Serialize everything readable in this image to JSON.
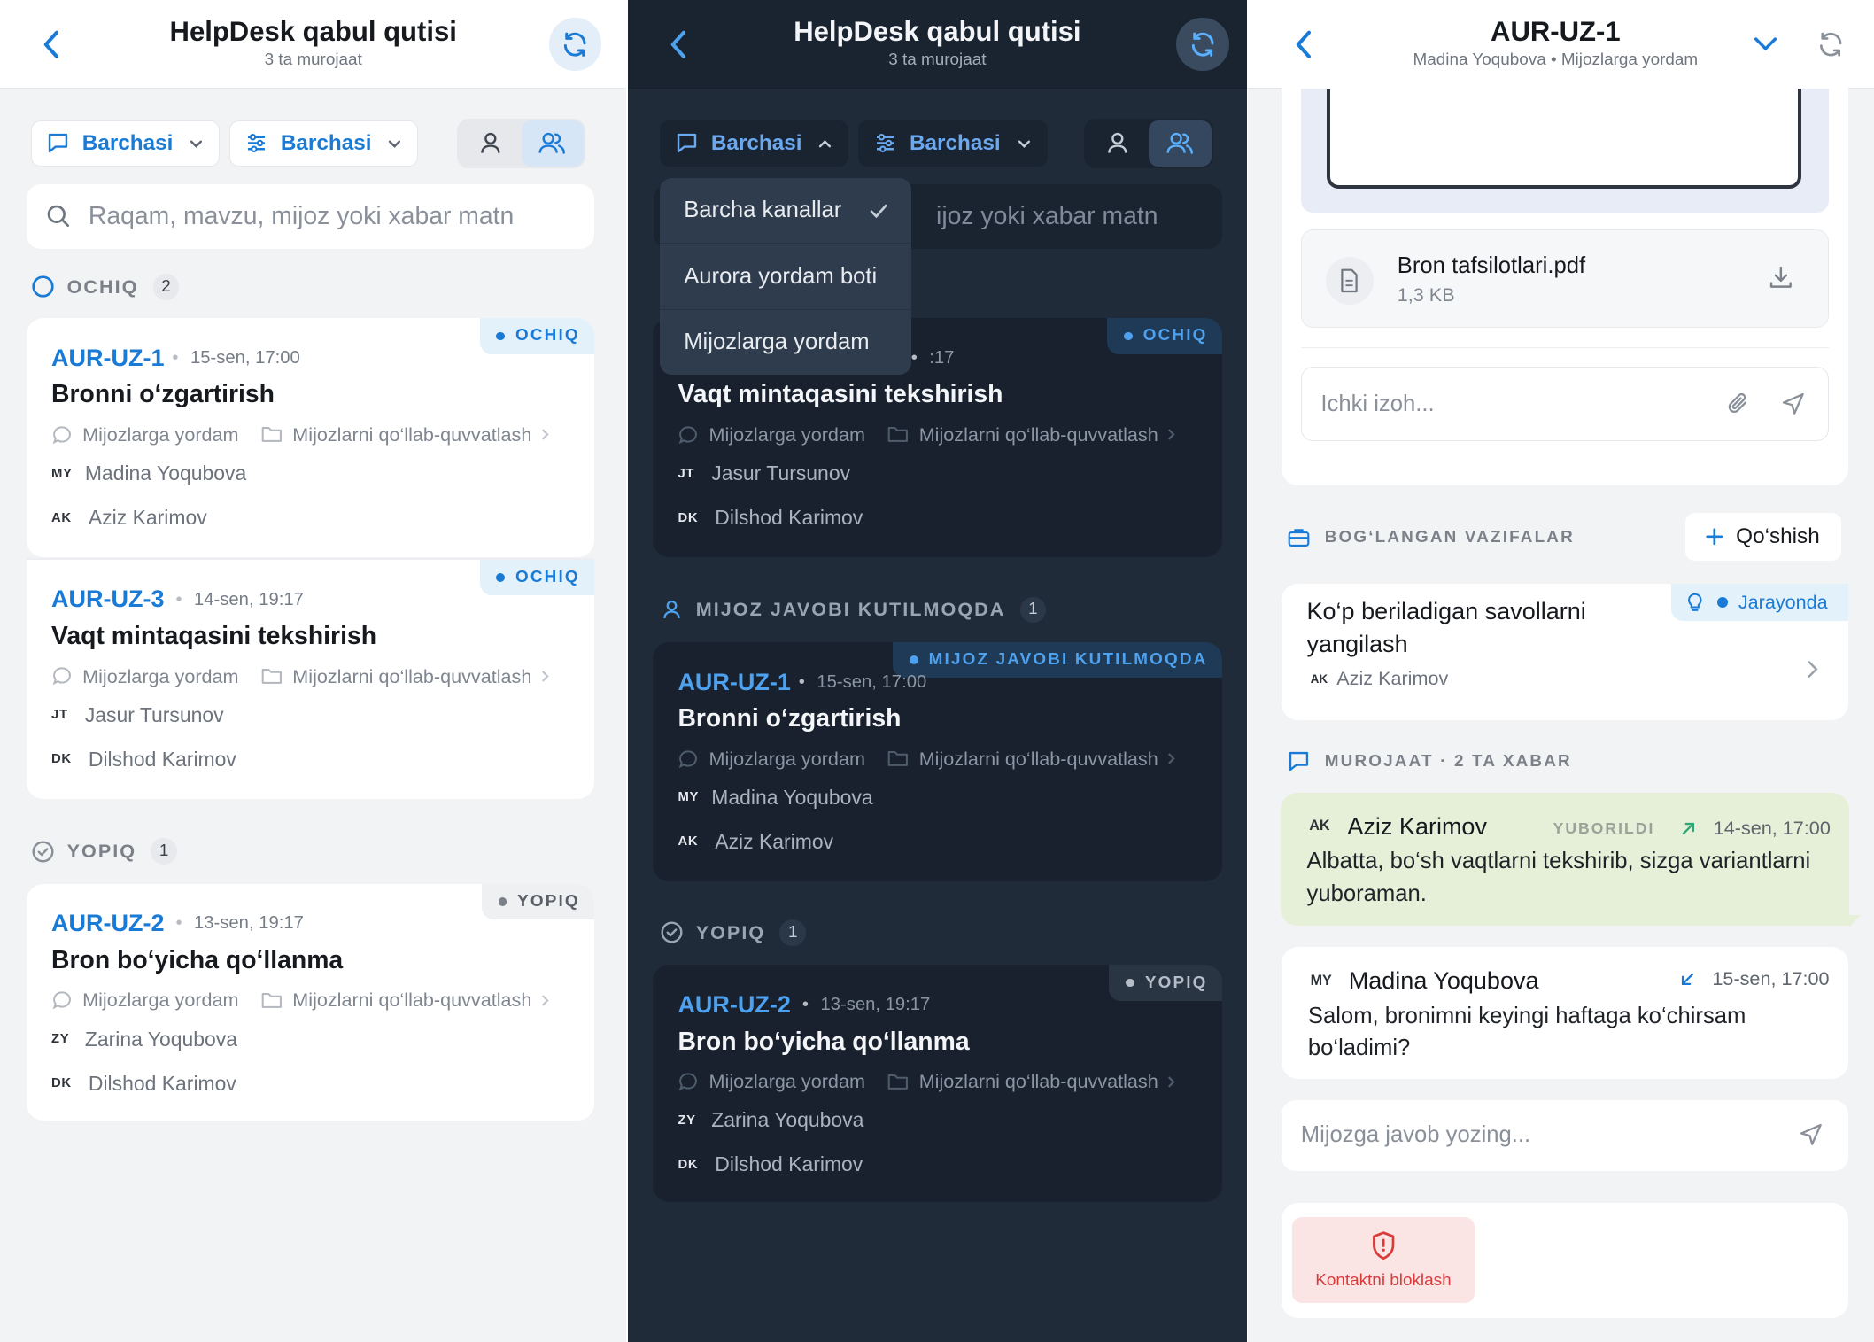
{
  "inbox": {
    "title": "HelpDesk qabul qutisi",
    "subtitle": "3 ta murojaat",
    "filter_channel": "Barchasi",
    "filter_team": "Barchasi",
    "search_placeholder": "Raqam, mavzu, mijoz yoki xabar matn",
    "search_partial": "ijoz yoki xabar matn"
  },
  "sections": {
    "open": {
      "label": "OCHIQ",
      "count": "2"
    },
    "closed": {
      "label": "YOPIQ",
      "count": "1"
    },
    "waiting": {
      "label": "MIJOZ JAVOBI KUTILMOQDA",
      "count": "1"
    }
  },
  "tickets": {
    "t1": {
      "id": "AUR-UZ-1",
      "date": "15-sen, 17:00",
      "title": "Bronni o‘zgartirish",
      "channel": "Mijozlarga yordam",
      "team": "Mijozlarni qo‘llab-quvvatlash",
      "customer_initials": "MY",
      "customer": "Madina Yoqubova",
      "agent_initials": "AK",
      "agent": "Aziz Karimov",
      "status": "OCHIQ",
      "status_dark": "MIJOZ JAVOBI KUTILMOQDA"
    },
    "t3": {
      "id": "AUR-UZ-3",
      "date": "14-sen, 19:17",
      "date_partial": ":17",
      "title": "Vaqt mintaqasini tekshirish",
      "channel": "Mijozlarga yordam",
      "team": "Mijozlarni qo‘llab-quvvatlash",
      "customer_initials": "JT",
      "customer": "Jasur Tursunov",
      "agent_initials": "DK",
      "agent": "Dilshod Karimov",
      "status": "OCHIQ"
    },
    "t2": {
      "id": "AUR-UZ-2",
      "date": "13-sen, 19:17",
      "title": "Bron bo‘yicha qo‘llanma",
      "channel": "Mijozlarga yordam",
      "team": "Mijozlarni qo‘llab-quvvatlash",
      "customer_initials": "ZY",
      "customer": "Zarina Yoqubova",
      "agent_initials": "DK",
      "agent": "Dilshod Karimov",
      "status": "YOPIQ"
    }
  },
  "channel_menu": {
    "items": [
      "Barcha kanallar",
      "Aurora yordam boti",
      "Mijozlarga yordam"
    ],
    "selected": "Barcha kanallar"
  },
  "detail": {
    "title": "AUR-UZ-1",
    "subtitle": "Madina Yoqubova • Mijozlarga yordam",
    "attachment_name": "Bron tafsilotlari.pdf",
    "attachment_size": "1,3 KB",
    "note_placeholder": "Ichki izoh...",
    "linked_tasks_label": "BOG‘LANGAN VAZIFALAR",
    "add_label": "Qo‘shish",
    "task_title": "Ko‘p beriladigan savollarni yangilash",
    "task_status": "Jarayonda",
    "task_assignee_initials": "AK",
    "task_assignee": "Aziz Karimov",
    "thread_label": "MUROJAAT · 2 TA XABAR",
    "messages": [
      {
        "initials": "AK",
        "name": "Aziz Karimov",
        "status": "YUBORILDI",
        "time": "14-sen, 17:00",
        "text": "Albatta, bo‘sh vaqtlarni tekshirib, sizga variantlarni yuboraman."
      },
      {
        "initials": "MY",
        "name": "Madina Yoqubova",
        "time": "15-sen, 17:00",
        "text": "Salom, bronimni keyingi haftaga ko‘chirsam bo‘ladimi?"
      }
    ],
    "reply_placeholder": "Mijozga javob yozing...",
    "block_label": "Kontaktni bloklash"
  },
  "colors": {
    "accent": "#1a7bd6",
    "dark_bg": "#202b39",
    "block_red": "#d93b3b",
    "sent_bubble": "#e6efd8"
  },
  "icons": [
    "chevron-left-icon",
    "refresh-icon",
    "chat-bubble-icon",
    "sliders-icon",
    "chevron-down-icon",
    "person-icon",
    "people-icon",
    "search-icon",
    "circle-open-icon",
    "check-circle-icon",
    "folder-icon",
    "check-icon",
    "file-icon",
    "download-icon",
    "paperclip-icon",
    "send-icon",
    "briefcase-icon",
    "plus-icon",
    "lightbulb-icon",
    "chevron-right-icon",
    "arrow-up-right-icon",
    "arrow-down-left-icon",
    "shield-alert-icon"
  ]
}
